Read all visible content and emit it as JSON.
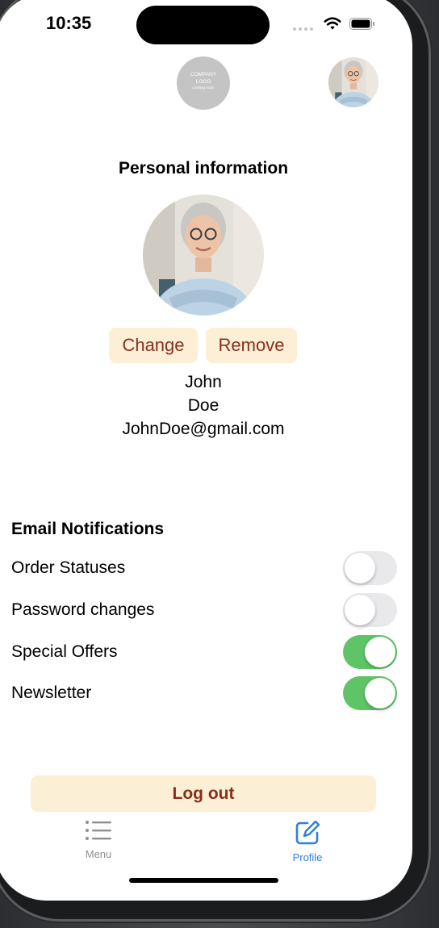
{
  "status_bar": {
    "time": "10:35"
  },
  "header": {
    "logo_line1": "COMPANY",
    "logo_line2": "LOGO",
    "logo_line3": "coming soon"
  },
  "profile": {
    "title": "Personal information",
    "change_label": "Change",
    "remove_label": "Remove",
    "first_name": "John",
    "last_name": "Doe",
    "email": "JohnDoe@gmail.com"
  },
  "notifications": {
    "title": "Email Notifications",
    "items": [
      {
        "label": "Order Statuses",
        "enabled": false
      },
      {
        "label": "Password changes",
        "enabled": false
      },
      {
        "label": "Special Offers",
        "enabled": true
      },
      {
        "label": "Newsletter",
        "enabled": true
      }
    ]
  },
  "actions": {
    "logout_label": "Log out"
  },
  "tab_bar": {
    "items": [
      {
        "label": "Menu",
        "icon": "list-icon",
        "selected": false
      },
      {
        "label": "Profile",
        "icon": "edit-square-icon",
        "selected": true
      }
    ]
  },
  "colors": {
    "accent_button_bg": "#fbefd6",
    "accent_button_text": "#8a2e1e",
    "toggle_on": "#5fc466",
    "toggle_off": "#e9e9eb",
    "tab_selected": "#2f7fe0",
    "tab_unselected": "#8e8e93"
  }
}
